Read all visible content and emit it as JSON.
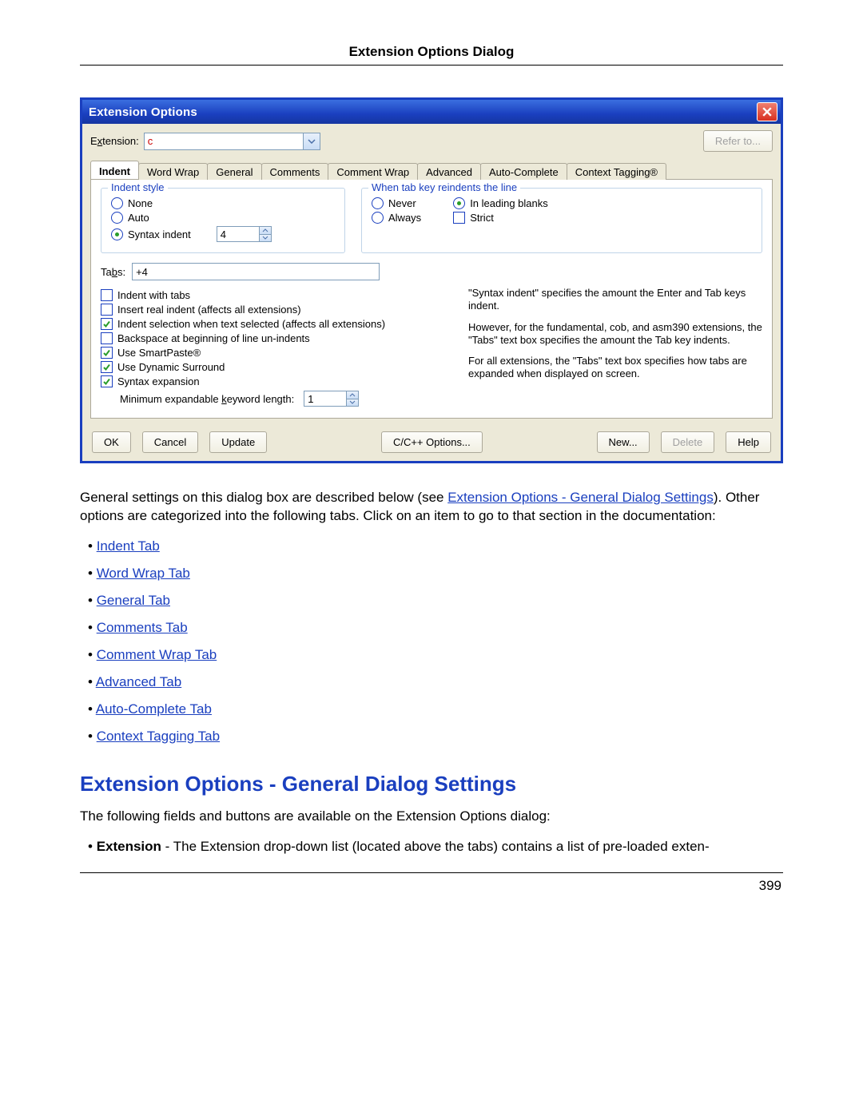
{
  "header": {
    "title": "Extension Options Dialog"
  },
  "dialog": {
    "title": "Extension Options",
    "extension_label_pre": "E",
    "extension_label_und": "x",
    "extension_label_post": "tension:",
    "extension_value": "c",
    "refer_to": "Refer to...",
    "tabs": [
      "Indent",
      "Word Wrap",
      "General",
      "Comments",
      "Comment Wrap",
      "Advanced",
      "Auto-Complete",
      "Context Tagging®"
    ],
    "group_indent_style": "Indent style",
    "radio_none": "None",
    "radio_auto": "Auto",
    "radio_syntax": "Syntax indent",
    "syntax_value": "4",
    "group_reindent": "When tab key reindents the line",
    "radio_never": "Never",
    "radio_always": "Always",
    "radio_leading": "In leading blanks",
    "chk_strict": "Strict",
    "tabs_label_pre": "Ta",
    "tabs_label_und": "b",
    "tabs_label_post": "s:",
    "tabs_value": "+4",
    "chk_indent_with_tabs": "Indent with tabs",
    "chk_insert_real": "Insert real indent (affects all extensions)",
    "chk_indent_sel": "Indent selection when text selected (affects all extensions)",
    "chk_backspace": "Backspace at beginning of line un-indents",
    "chk_smartpaste": "Use SmartPaste®",
    "chk_dyn_surround": "Use Dynamic Surround",
    "chk_syntax_exp": "Syntax expansion",
    "min_label_pre": "Minimum expandable ",
    "min_label_und": "k",
    "min_label_post": "eyword length:",
    "min_value": "1",
    "help_p1": "\"Syntax indent\" specifies the amount the Enter and Tab  keys indent.",
    "help_p2": "However, for the fundamental, cob, and asm390 extensions, the \"Tabs\" text box specifies the amount the Tab key indents.",
    "help_p3": " For all extensions, the \"Tabs\" text box specifies how tabs are expanded when displayed on screen.",
    "buttons": {
      "ok": "OK",
      "cancel": "Cancel",
      "update": "Update",
      "lang": "C/C++ Options...",
      "new": "New...",
      "delete": "Delete",
      "help": "Help"
    }
  },
  "body": {
    "para1_a": "General settings on this dialog box are described below (see ",
    "para1_link": "Extension Options - General Dialog Settings",
    "para1_b": "). Other options are categorized into the following tabs. Click on an item to go to that section in the documentation:",
    "tabs": [
      "Indent Tab",
      "Word Wrap Tab",
      "General Tab",
      "Comments Tab",
      "Comment Wrap Tab",
      "Advanced Tab",
      "Auto-Complete Tab",
      "Context Tagging Tab"
    ],
    "heading": "Extension Options - General Dialog Settings",
    "para2": "The following fields and buttons are available on the Extension Options dialog:",
    "bullet_a": "Extension",
    "bullet_b": " - The Extension drop-down list (located above the tabs) contains a list of pre-loaded exten-"
  },
  "page_number": "399"
}
